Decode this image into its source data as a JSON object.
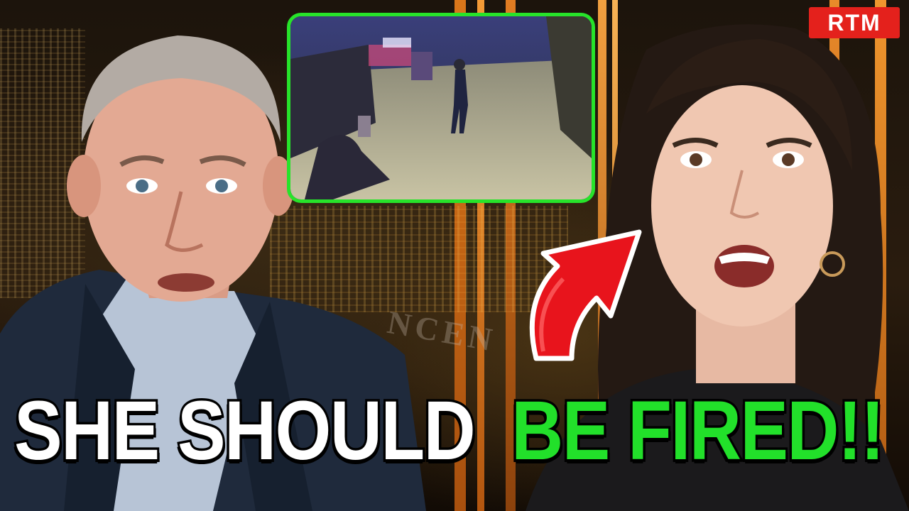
{
  "thumbnail": {
    "headline_part1": "SHE SHOULD",
    "headline_part2": "BE FIRED!!",
    "logo_text": "RTM",
    "set_letters": "NCEN"
  },
  "colors": {
    "headline_white": "#ffffff",
    "headline_green": "#22e02a",
    "video_border": "#27e32a",
    "logo_red": "#e4211c",
    "arrow_red": "#e8141c",
    "background": "#140d07"
  },
  "icons": {
    "arrow": "curved-arrow-icon"
  }
}
